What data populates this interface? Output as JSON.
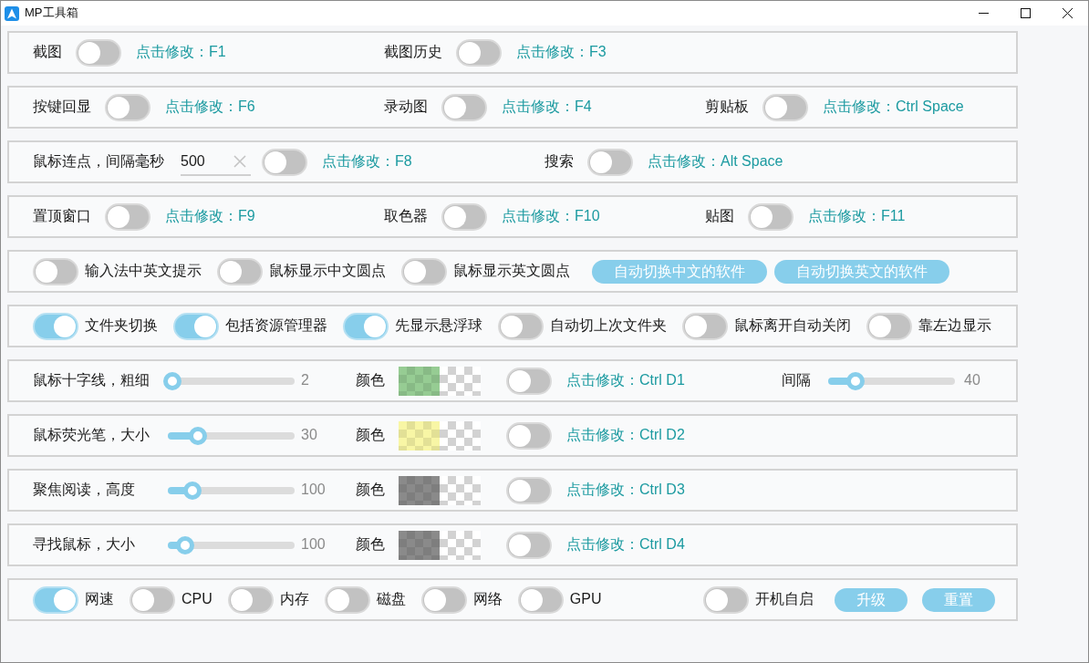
{
  "window": {
    "title": "MP工具箱"
  },
  "panels": [
    {
      "kind": "hotkeys",
      "items": [
        {
          "label": "截图",
          "on": false,
          "hotkey": "点击修改：F1"
        },
        {
          "label": "截图历史",
          "on": false,
          "hotkey": "点击修改：F3"
        }
      ]
    },
    {
      "kind": "hotkeys",
      "items": [
        {
          "label": "按键回显",
          "on": false,
          "hotkey": "点击修改：F6"
        },
        {
          "label": "录动图",
          "on": false,
          "hotkey": "点击修改：F4"
        },
        {
          "label": "剪贴板",
          "on": false,
          "hotkey": "点击修改：Ctrl Space"
        }
      ]
    },
    {
      "kind": "hotkeys",
      "items": [
        {
          "label": "鼠标连点，间隔毫秒",
          "field": {
            "value": "500"
          },
          "on": false,
          "hotkey": "点击修改：F8"
        },
        {
          "label": "搜索",
          "on": false,
          "hotkey": "点击修改：Alt Space"
        }
      ]
    },
    {
      "kind": "hotkeys",
      "items": [
        {
          "label": "置顶窗口",
          "on": false,
          "hotkey": "点击修改：F9"
        },
        {
          "label": "取色器",
          "on": false,
          "hotkey": "点击修改：F10"
        },
        {
          "label": "贴图",
          "on": false,
          "hotkey": "点击修改：F11"
        }
      ]
    },
    {
      "kind": "switches",
      "items": [
        {
          "kind": "switch",
          "label": "输入法中英文提示",
          "on": false
        },
        {
          "kind": "switch",
          "label": "鼠标显示中文圆点",
          "on": false
        },
        {
          "kind": "switch",
          "label": "鼠标显示英文圆点",
          "on": false
        },
        {
          "kind": "button",
          "label": "自动切换中文的软件"
        },
        {
          "kind": "button",
          "label": "自动切换英文的软件"
        }
      ]
    },
    {
      "kind": "switches",
      "items": [
        {
          "kind": "switch",
          "label": "文件夹切换",
          "on": true
        },
        {
          "kind": "switch",
          "label": "包括资源管理器",
          "on": true
        },
        {
          "kind": "switch",
          "label": "先显示悬浮球",
          "on": true
        },
        {
          "kind": "switch",
          "label": "自动切上次文件夹",
          "on": false
        },
        {
          "kind": "switch",
          "label": "鼠标离开自动关闭",
          "on": false
        },
        {
          "kind": "switch",
          "label": "靠左边显示",
          "on": false
        }
      ]
    },
    {
      "kind": "effect",
      "label": "鼠标十字线，粗细",
      "slider": {
        "level": 0,
        "reading": "2"
      },
      "swatch": {
        "label": "颜色",
        "color": "#96cc93"
      },
      "on": false,
      "hotkey": "点击修改：Ctrl D1",
      "extra": {
        "label": "间隔",
        "slider": {
          "level": 0.19,
          "reading": "40"
        }
      }
    },
    {
      "kind": "effect",
      "label": "鼠标荧光笔，大小",
      "slider": {
        "level": 0.22,
        "reading": "30"
      },
      "swatch": {
        "label": "颜色",
        "color": "#f8f6a5"
      },
      "on": false,
      "hotkey": "点击修改：Ctrl D2"
    },
    {
      "kind": "effect",
      "label": "聚焦阅读，高度",
      "slider": {
        "level": 0.17,
        "reading": "100"
      },
      "swatch": {
        "label": "颜色",
        "color": "#8a8a8a"
      },
      "on": false,
      "hotkey": "点击修改：Ctrl D3"
    },
    {
      "kind": "effect",
      "label": "寻找鼠标，大小",
      "slider": {
        "level": 0.11,
        "reading": "100"
      },
      "swatch": {
        "label": "颜色",
        "color": "#8a8a8a"
      },
      "on": false,
      "hotkey": "点击修改：Ctrl D4"
    },
    {
      "kind": "footer",
      "monitors": [
        {
          "label": "网速",
          "on": true
        },
        {
          "label": "CPU",
          "on": false
        },
        {
          "label": "内存",
          "on": false
        },
        {
          "label": "磁盘",
          "on": false
        },
        {
          "label": "网络",
          "on": false
        },
        {
          "label": "GPU",
          "on": false
        }
      ],
      "autostart": {
        "label": "开机自启",
        "on": false
      },
      "buttons": [
        "升级",
        "重置"
      ]
    }
  ]
}
